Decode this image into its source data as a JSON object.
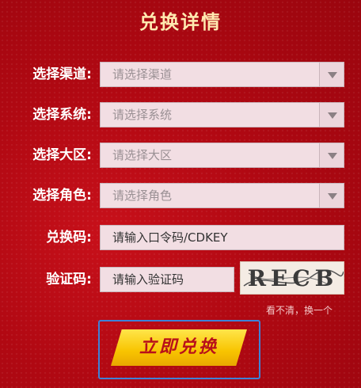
{
  "page_title": "兑换详情",
  "form": {
    "channel": {
      "label": "选择渠道:",
      "placeholder": "请选择渠道"
    },
    "system": {
      "label": "选择系统:",
      "placeholder": "请选择系统"
    },
    "region": {
      "label": "选择大区:",
      "placeholder": "请选择大区"
    },
    "role": {
      "label": "选择角色:",
      "placeholder": "请选择角色"
    },
    "code": {
      "label": "兑换码:",
      "placeholder": "请输入口令码/CDKEY"
    },
    "captcha": {
      "label": "验证码:",
      "placeholder": "请输入验证码",
      "image_text": "RECB",
      "refresh_link": "看不清，换一个"
    }
  },
  "submit_label": "立即兑换",
  "colors": {
    "background": "#b00812",
    "title": "#ffe9b0",
    "button": "#f8c400",
    "button_text": "#b8101a",
    "focus_border": "#3d82d8"
  },
  "icons": [
    "dropdown-arrow-icon"
  ]
}
